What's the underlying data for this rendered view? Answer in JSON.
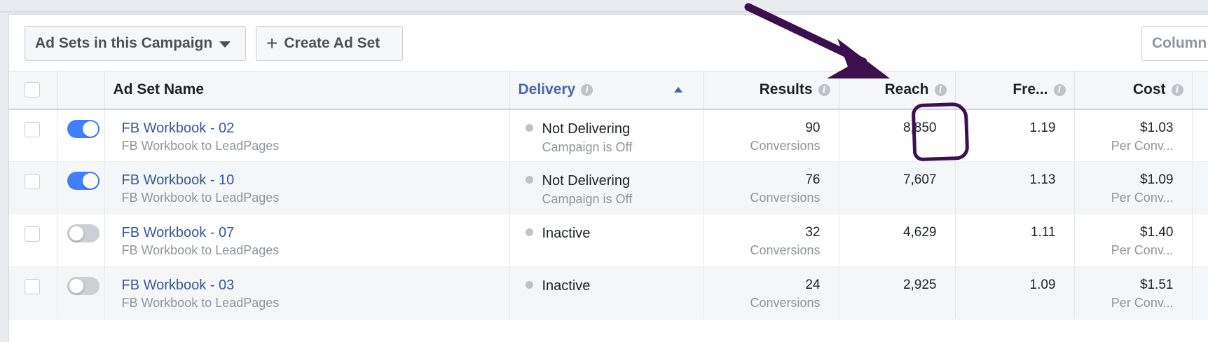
{
  "toolbar": {
    "adsets_label": "Ad Sets in this Campaign",
    "create_label": "Create Ad Set",
    "columns_label": "Column"
  },
  "table": {
    "headers": {
      "name": "Ad Set Name",
      "delivery": "Delivery",
      "results": "Results",
      "reach": "Reach",
      "frequency": "Fre...",
      "cost": "Cost"
    },
    "rows": [
      {
        "name": "FB Workbook - 02",
        "campaign": "FB Workbook to LeadPages",
        "enabled": true,
        "delivery": "Not Delivering",
        "delivery_sub": "Campaign is Off",
        "results": "90",
        "results_sub": "Conversions",
        "reach": "8,850",
        "frequency": "1.19",
        "cost": "$1.03",
        "cost_sub": "Per Conv..."
      },
      {
        "name": "FB Workbook - 10",
        "campaign": "FB Workbook to LeadPages",
        "enabled": true,
        "delivery": "Not Delivering",
        "delivery_sub": "Campaign is Off",
        "results": "76",
        "results_sub": "Conversions",
        "reach": "7,607",
        "frequency": "1.13",
        "cost": "$1.09",
        "cost_sub": "Per Conv..."
      },
      {
        "name": "FB Workbook - 07",
        "campaign": "FB Workbook to LeadPages",
        "enabled": false,
        "delivery": "Inactive",
        "delivery_sub": "",
        "results": "32",
        "results_sub": "Conversions",
        "reach": "4,629",
        "frequency": "1.11",
        "cost": "$1.40",
        "cost_sub": "Per Conv..."
      },
      {
        "name": "FB Workbook - 03",
        "campaign": "FB Workbook to LeadPages",
        "enabled": false,
        "delivery": "Inactive",
        "delivery_sub": "",
        "results": "24",
        "results_sub": "Conversions",
        "reach": "2,925",
        "frequency": "1.09",
        "cost": "$1.51",
        "cost_sub": "Per Conv..."
      }
    ]
  },
  "icons": {
    "info": "info-icon",
    "sort": "sort-ascending-icon",
    "plus": "plus-icon",
    "caret": "caret-down-icon"
  },
  "colors": {
    "link": "#365899",
    "accent": "#4267b2",
    "toggle_on": "#4080ff",
    "annotation": "#3c0f4f"
  }
}
